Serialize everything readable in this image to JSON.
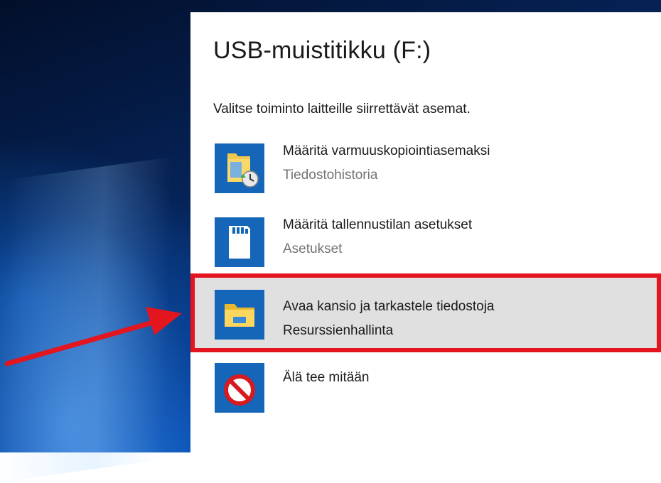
{
  "dialog": {
    "title": "USB-muistitikku (F:)",
    "subtitle": "Valitse toiminto laitteille siirrettävät asemat.",
    "options": [
      {
        "label": "Määritä varmuuskopiointiasemaksi",
        "sublabel": "Tiedostohistoria",
        "icon": "file-history-icon"
      },
      {
        "label": "Määritä tallennustilan asetukset",
        "sublabel": "Asetukset",
        "icon": "sd-card-icon"
      },
      {
        "label": "Avaa kansio ja tarkastele tiedostoja",
        "sublabel": "Resurssienhallinta",
        "icon": "file-explorer-icon",
        "highlighted": true
      },
      {
        "label": "Älä tee mitään",
        "sublabel": "",
        "icon": "no-action-icon"
      }
    ]
  },
  "colors": {
    "tile_blue": "#1565b8",
    "highlight_gray": "#e0e0e0",
    "callout_red": "#e3151e",
    "secondary_text": "#737373"
  }
}
